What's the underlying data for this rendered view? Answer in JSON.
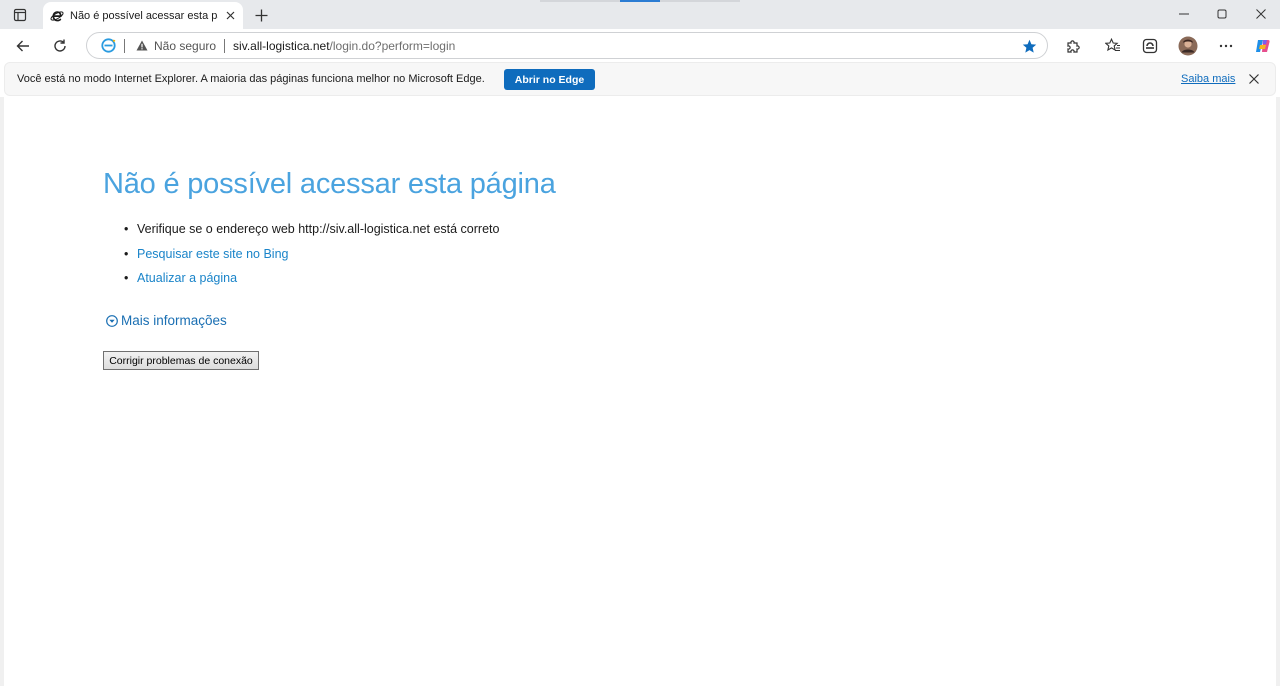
{
  "tab": {
    "title": "Não é possível acessar esta página"
  },
  "address_bar": {
    "security_label": "Não seguro",
    "url_host": "siv.all-logistica.net",
    "url_path": "/login.do?perform=login"
  },
  "ie_mode_bar": {
    "message": "Você está no modo Internet Explorer. A maioria das páginas funciona melhor no Microsoft Edge.",
    "open_button": "Abrir no Edge",
    "learn_more": "Saiba mais"
  },
  "page": {
    "title": "Não é possível acessar esta página",
    "suggestions": [
      {
        "text": "Verifique se o endereço web http://siv.all-logistica.net está correto",
        "link": false
      },
      {
        "text": "Pesquisar este site no Bing",
        "link": true
      },
      {
        "text": "Atualizar a página",
        "link": true
      }
    ],
    "more_info": "Mais informações",
    "fix_button": "Corrigir problemas de conexão"
  },
  "colors": {
    "title_blue": "#4aa3df",
    "link_blue": "#1a84c9",
    "edge_button": "#0f6cbd",
    "favorite_star": "#0f6cbd"
  },
  "icons": [
    "tab-actions-icon",
    "ie-icon",
    "close-icon",
    "plus-icon",
    "minimize-icon",
    "maximize-icon",
    "back-icon",
    "refresh-icon",
    "warning-icon",
    "star-icon",
    "extensions-icon",
    "favorites-icon",
    "collections-icon",
    "profile-icon",
    "more-icon",
    "copilot-icon",
    "chevron-down-circle-icon"
  ]
}
